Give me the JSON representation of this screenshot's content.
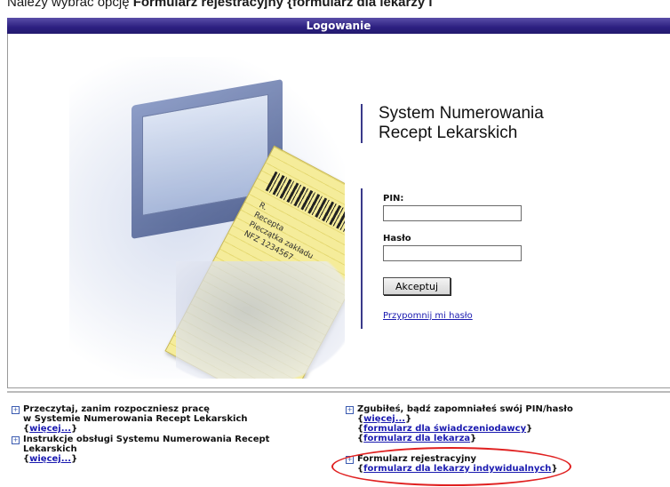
{
  "instruction": {
    "prefix": "Należy wybrać opcję ",
    "bold": "Formularz rejestracyjny {formularz dla lekarzy i"
  },
  "window": {
    "title": "Logowanie"
  },
  "hero": {
    "rx_lines": [
      "R.",
      "Recepta",
      "Pieczątka zakładu",
      "NFZ 1234567"
    ]
  },
  "system": {
    "title_line1": "System Numerowania",
    "title_line2": "Recept Lekarskich"
  },
  "login": {
    "pin_label": "PIN:",
    "password_label": "Hasło",
    "accept_label": "Akceptuj",
    "forgot_link": "Przypomnij mi hasło"
  },
  "info": {
    "read_line1": "Przeczytaj, zanim rozpoczniesz pracę",
    "read_line2": "w Systemie Numerowania Recept Lekarskich",
    "read_more": "więcej...",
    "manual_line1": "Instrukcje obsługi Systemu Numerowania Recept",
    "manual_line2": "Lekarskich",
    "manual_more": "więcej...",
    "lost_line1": "Zgubiłeś, bądź zapomniałeś swój PIN/hasło",
    "lost_more": "więcej...",
    "lost_form_provider": "formularz dla świadczeniodawcy",
    "lost_form_doctor": "formularz dla lekarza",
    "reg_title": "Formularz rejestracyjny",
    "reg_link": "formularz dla lekarzy indywidualnych"
  },
  "colors": {
    "titlebar": "#2c1f80",
    "link": "#1a1ab0",
    "highlight": "#e02020"
  }
}
